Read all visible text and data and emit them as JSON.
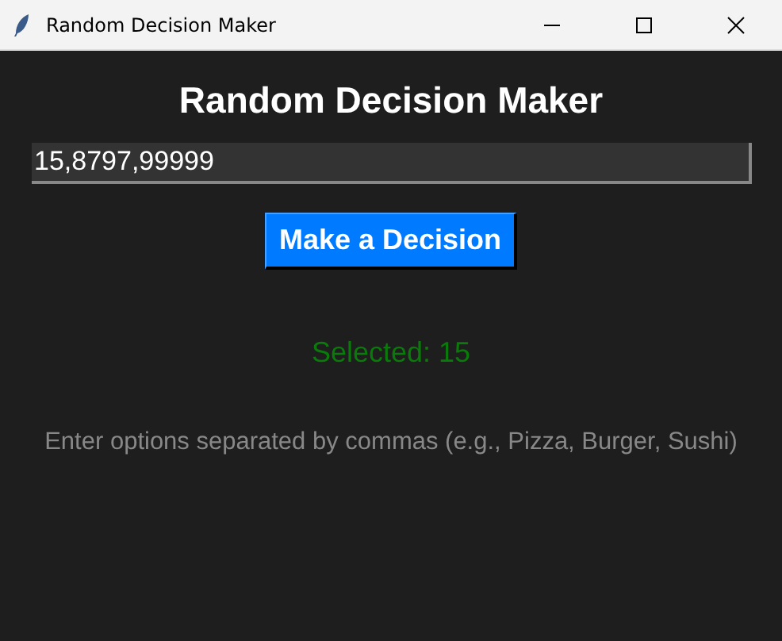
{
  "window": {
    "title": "Random Decision Maker"
  },
  "heading": "Random Decision Maker",
  "options_field": {
    "value": "15,8797,99999"
  },
  "button": "Make a Decision",
  "result": "Selected: 15",
  "hint": "Enter options separated by commas (e.g., Pizza, Burger, Sushi)"
}
